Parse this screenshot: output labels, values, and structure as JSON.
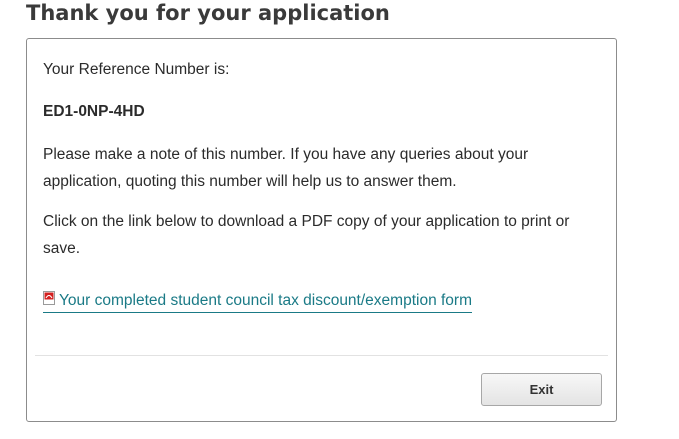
{
  "page": {
    "title": "Thank you for your application"
  },
  "confirmation": {
    "reference_label": "Your Reference Number is:",
    "reference_number": "ED1-0NP-4HD",
    "note_text": "Please make a note of this number. If you have any queries about your application, quoting this number will help us to answer them.",
    "download_text": "Click on the link below to download a PDF copy of your application to print or save.",
    "pdf_link_label": "Your completed student council tax discount/exemption form",
    "pdf_icon": "pdf-file-icon"
  },
  "actions": {
    "exit_label": "Exit"
  },
  "colors": {
    "link": "#1a7a86",
    "pdf_icon_red": "#d32020"
  }
}
